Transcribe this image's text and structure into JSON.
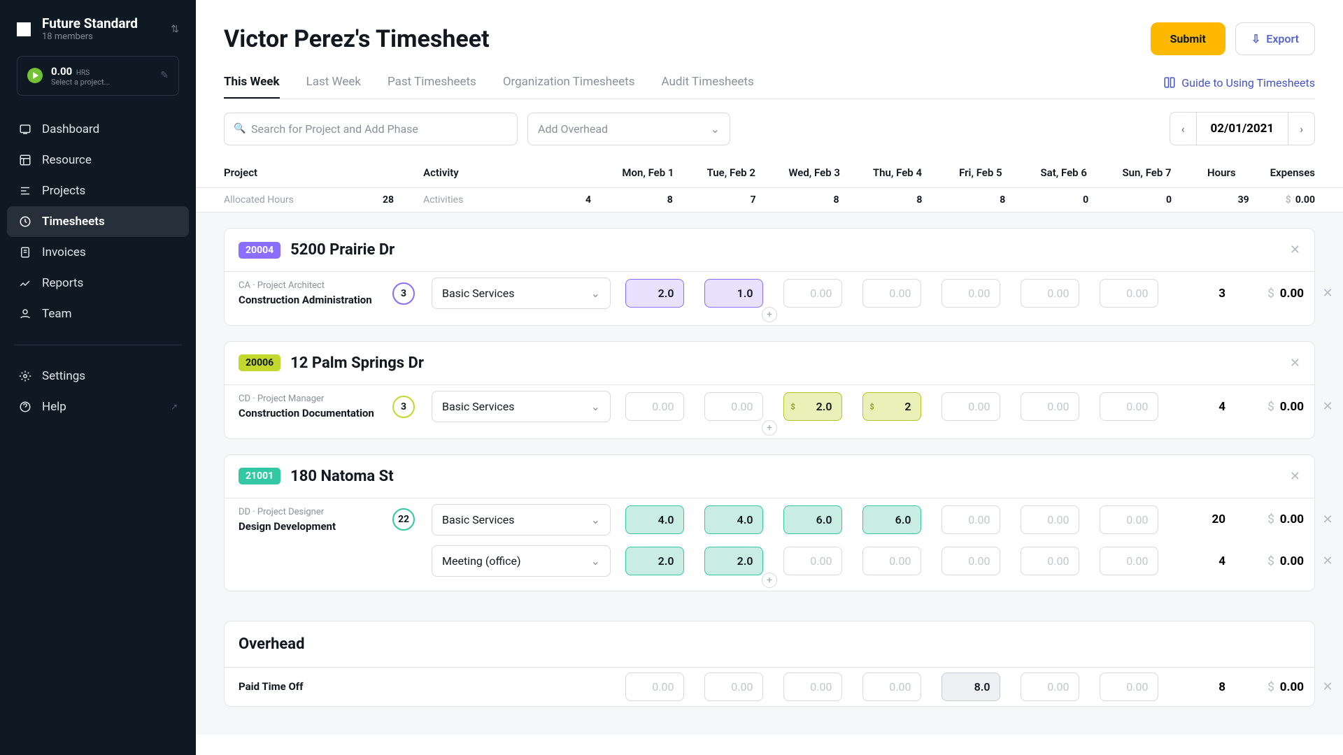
{
  "brand": {
    "title": "Future Standard",
    "subtitle": "18 members"
  },
  "timer": {
    "hours": "0.00",
    "hrs_label": "HRS",
    "subtitle": "Select a project..."
  },
  "nav": [
    {
      "label": "Dashboard"
    },
    {
      "label": "Resource"
    },
    {
      "label": "Projects"
    },
    {
      "label": "Timesheets"
    },
    {
      "label": "Invoices"
    },
    {
      "label": "Reports"
    },
    {
      "label": "Team"
    }
  ],
  "nav2": [
    {
      "label": "Settings"
    },
    {
      "label": "Help"
    }
  ],
  "page_title": "Victor Perez's Timesheet",
  "buttons": {
    "submit": "Submit",
    "export": "Export"
  },
  "tabs": [
    "This Week",
    "Last Week",
    "Past Timesheets",
    "Organization Timesheets",
    "Audit Timesheets"
  ],
  "guide": "Guide to Using Timesheets",
  "search_placeholder": "Search for Project and Add Phase",
  "overhead_placeholder": "Add Overhead",
  "date": "02/01/2021",
  "headers": {
    "project": "Project",
    "activity": "Activity",
    "mon": "Mon, Feb 1",
    "tue": "Tue, Feb 2",
    "wed": "Wed, Feb 3",
    "thu": "Thu, Feb 4",
    "fri": "Fri, Feb 5",
    "sat": "Sat, Feb 6",
    "sun": "Sun, Feb 7",
    "hours": "Hours",
    "expenses": "Expenses"
  },
  "allocated": {
    "label": "Allocated Hours",
    "total": "28",
    "activities": "Activities",
    "mon": "4",
    "tue": "8",
    "wed": "7",
    "thu": "8",
    "fri": "8",
    "sat": "8",
    "sun": "0",
    "sun2": "0",
    "hours": "39",
    "exp": "0.00",
    "cur": "$"
  },
  "projects": [
    {
      "badge": "20004",
      "color": "purple",
      "name": "5200 Prairie Dr",
      "rows": [
        {
          "role": "CA · Project Architect",
          "phase": "Construction Administration",
          "budget": "3",
          "activity": "Basic Services",
          "cells": [
            "2.0",
            "1.0",
            "0.00",
            "0.00",
            "0.00",
            "0.00",
            "0.00"
          ],
          "filled": [
            true,
            true,
            false,
            false,
            false,
            false,
            false
          ],
          "hours": "3",
          "exp": "0.00"
        }
      ]
    },
    {
      "badge": "20006",
      "color": "lime",
      "name": "12 Palm Springs Dr",
      "rows": [
        {
          "role": "CD · Project Manager",
          "phase": "Construction Documentation",
          "budget": "3",
          "activity": "Basic Services",
          "cells": [
            "0.00",
            "0.00",
            "2.0",
            "2",
            "0.00",
            "0.00",
            "0.00"
          ],
          "filled": [
            false,
            false,
            true,
            true,
            false,
            false,
            false
          ],
          "hours": "4",
          "exp": "0.00"
        }
      ]
    },
    {
      "badge": "21001",
      "color": "teal",
      "name": "180 Natoma St",
      "rows": [
        {
          "role": "DD · Project Designer",
          "phase": "Design Development",
          "budget": "22",
          "activity": "Basic Services",
          "cells": [
            "4.0",
            "4.0",
            "6.0",
            "6.0",
            "0.00",
            "0.00",
            "0.00"
          ],
          "filled": [
            true,
            true,
            true,
            true,
            false,
            false,
            false
          ],
          "hours": "20",
          "exp": "0.00"
        },
        {
          "role": "",
          "phase": "",
          "budget": "",
          "activity": "Meeting (office)",
          "cells": [
            "2.0",
            "2.0",
            "0.00",
            "0.00",
            "0.00",
            "0.00",
            "0.00"
          ],
          "filled": [
            true,
            true,
            false,
            false,
            false,
            false,
            false
          ],
          "hours": "4",
          "exp": "0.00"
        }
      ]
    }
  ],
  "overhead": {
    "title": "Overhead",
    "row": {
      "label": "Paid Time Off",
      "cells": [
        "0.00",
        "0.00",
        "0.00",
        "0.00",
        "8.0",
        "0.00",
        "0.00"
      ],
      "filled": [
        false,
        false,
        false,
        false,
        true,
        false,
        false
      ],
      "color": "gray",
      "hours": "8",
      "exp": "0.00"
    }
  }
}
